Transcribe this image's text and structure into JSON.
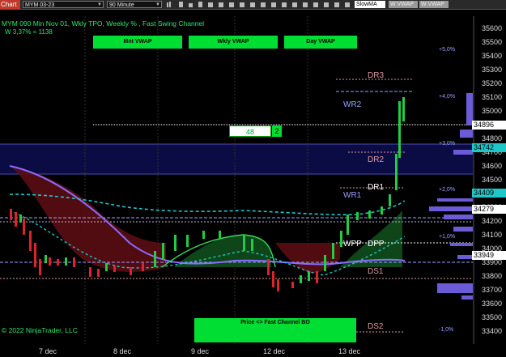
{
  "toolbar": {
    "tab_label": "Chart",
    "instrument": "MYM 03-23",
    "timeframe": "90 Minute",
    "indicator_boxes": [
      "SlowMA",
      "W VWAP",
      "W VWAP"
    ]
  },
  "header": {
    "title": "MYM 090 Min Nov 01, Wkly TPO, Weekly % , Fast Swing Channel",
    "subtitle": "W 3,37% = 1138"
  },
  "vwap_buttons": [
    "Mnt VWAP",
    "Wkly VWAP",
    "Day VWAP"
  ],
  "signal": {
    "value": "48",
    "level": "2"
  },
  "price_axis": {
    "ticks": [
      "35600",
      "35500",
      "35400",
      "35300",
      "35200",
      "35100",
      "35000",
      "34900",
      "34800",
      "34700",
      "34600",
      "34500",
      "34400",
      "34300",
      "34200",
      "34100",
      "34000",
      "33900",
      "33800",
      "33700",
      "33600",
      "33500",
      "33400"
    ],
    "tags": [
      {
        "label": "34896",
        "color": "#ffffff"
      },
      {
        "label": "34742",
        "color": "#1ec8c8"
      },
      {
        "label": "34409",
        "color": "#1ec8c8"
      },
      {
        "label": "34279",
        "color": "#ffffff"
      },
      {
        "label": "33949",
        "color": "#ffffff"
      }
    ]
  },
  "pct_labels": [
    "+5,0%",
    "+4,0%",
    "+3,0%",
    "+2,0%",
    "+1,0%",
    "-1,0%"
  ],
  "levels": [
    "DR3",
    "WR2",
    "DR2",
    "DR1",
    "WR1",
    "WPP",
    "DPP",
    "DS1",
    "DS2"
  ],
  "x_axis": [
    "7 dec",
    "8 dec",
    "9 dec",
    "12 dec",
    "13 dec"
  ],
  "footer": {
    "copyright": "© 2022 NinjaTrader, LLC",
    "channel_button": "Price <> Fast Channel BO"
  },
  "colors": {
    "accent_green": "#00dd33",
    "header_green": "#2ee66b",
    "pivot_label": "#d89aa0",
    "weekly_label": "#9aa0ff",
    "cyan": "#1ec8c8",
    "bear_channel": "#5a0d14",
    "bull_channel": "#0f4a1a",
    "volume_profile": "#6b5bd6"
  }
}
